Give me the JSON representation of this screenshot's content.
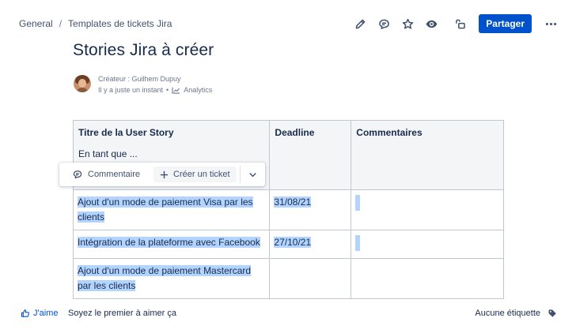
{
  "breadcrumb": {
    "items": [
      "General",
      "Templates de tickets Jira"
    ],
    "separator": "/"
  },
  "header": {
    "share_label": "Partager",
    "accent_color": "#0052cc"
  },
  "page": {
    "title": "Stories Jira à créer",
    "byline": {
      "author_line": "Créateur : Guilhem Dupuy",
      "time_line": "Il y a juste un instant",
      "bullet": "•",
      "analytics_label": "Analytics"
    }
  },
  "table": {
    "headers": [
      "Titre de la User Story",
      "Deadline",
      "Commentaires"
    ],
    "header_subtext": "En tant que ...",
    "rows": [
      {
        "title": "Ajout d'un mode de paiement Visa par les clients",
        "deadline": "31/08/21",
        "comment": ""
      },
      {
        "title": "Intégration de la plateforme avec Facebook",
        "deadline": "27/10/21",
        "comment": ""
      },
      {
        "title": "Ajout d'un mode de paiement Mastercard par les clients",
        "deadline": "",
        "comment": ""
      }
    ]
  },
  "floating_toolbar": {
    "comment_label": "Commentaire",
    "create_ticket_label": "Créer un ticket"
  },
  "footer": {
    "like_label": "J'aime",
    "like_first": "Soyez le premier à aimer ça",
    "no_label": "Aucune étiquette"
  },
  "icons": [
    "pencil-icon",
    "comment-icon",
    "star-icon",
    "eye-icon",
    "unlock-icon",
    "more-icon",
    "analytics-icon",
    "plus-icon",
    "chevron-down-icon",
    "thumbs-up-icon",
    "tag-icon"
  ],
  "colors": {
    "selection": "#b3d4ff",
    "text": "#172b4d",
    "header_bg": "#f4f5f7"
  }
}
